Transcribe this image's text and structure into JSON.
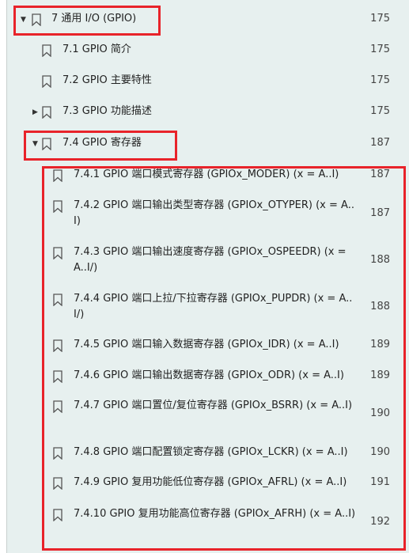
{
  "toc": [
    {
      "label": "7 通用 I/O (GPIO)",
      "page": "175",
      "toggle": "▼"
    },
    {
      "label": "7.1 GPIO 简介",
      "page": "175"
    },
    {
      "label": "7.2 GPIO 主要特性",
      "page": "175"
    },
    {
      "label": "7.3 GPIO 功能描述",
      "page": "175",
      "toggle": "▶"
    },
    {
      "label": "7.4 GPIO 寄存器",
      "page": "187",
      "toggle": "▼"
    },
    {
      "label": "7.4.1 GPIO 端口模式寄存器 (GPIOx_MODER) (x = A..I)",
      "page": "187"
    },
    {
      "label": "7.4.2 GPIO 端口输出类型寄存器 (GPIOx_OTYPER) (x = A..I)",
      "page": "187"
    },
    {
      "label": "7.4.3 GPIO 端口输出速度寄存器 (GPIOx_OSPEEDR) (x = A..I/)",
      "page": "188"
    },
    {
      "label": "7.4.4 GPIO 端口上拉/下拉寄存器 (GPIOx_PUPDR) (x = A..I/)",
      "page": "188"
    },
    {
      "label": "7.4.5 GPIO 端口输入数据寄存器 (GPIOx_IDR) (x = A..I)",
      "page": "189"
    },
    {
      "label": "7.4.6 GPIO 端口输出数据寄存器 (GPIOx_ODR) (x = A..I)",
      "page": "189"
    },
    {
      "label": "7.4.7 GPIO 端口置位/复位寄存器 (GPIOx_BSRR) (x = A..I)",
      "page": "190"
    },
    {
      "label": "7.4.8 GPIO 端口配置锁定寄存器 (GPIOx_LCKR) (x = A..I)",
      "page": "190"
    },
    {
      "label": "7.4.9 GPIO 复用功能低位寄存器 (GPIOx_AFRL) (x = A..I)",
      "page": "191"
    },
    {
      "label": "7.4.10 GPIO 复用功能高位寄存器 (GPIOx_AFRH) (x = A..I)",
      "page": "192"
    }
  ],
  "icons": {
    "bookmark": "bookmark-icon",
    "expanded": "chevron-down-icon",
    "collapsed": "chevron-right-icon"
  },
  "colors": {
    "panel_bg": "#e7f0ef",
    "highlight": "#e8232a"
  }
}
